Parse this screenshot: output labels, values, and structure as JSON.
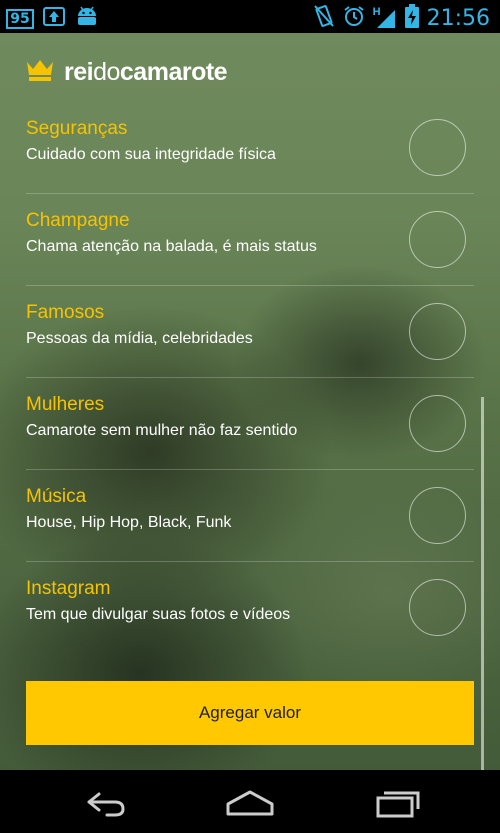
{
  "status_bar": {
    "notification_count": "95",
    "time": "21:56",
    "network": "H"
  },
  "app": {
    "logo": {
      "rei": "rei",
      "do": "do",
      "camarote": "camarote"
    }
  },
  "items": [
    {
      "title": "Seguranças",
      "subtitle": "Cuidado com sua integridade física"
    },
    {
      "title": "Champagne",
      "subtitle": "Chama atenção na balada, é mais status"
    },
    {
      "title": "Famosos",
      "subtitle": "Pessoas da mídia, celebridades"
    },
    {
      "title": "Mulheres",
      "subtitle": "Camarote sem mulher não faz sentido"
    },
    {
      "title": "Música",
      "subtitle": "House, Hip Hop, Black, Funk"
    },
    {
      "title": "Instagram",
      "subtitle": "Tem que divulgar suas fotos e vídeos"
    }
  ],
  "cta": {
    "label": "Agregar valor"
  },
  "colors": {
    "accent": "#ffc800",
    "title": "#f5c300",
    "status": "#33b5e5"
  }
}
